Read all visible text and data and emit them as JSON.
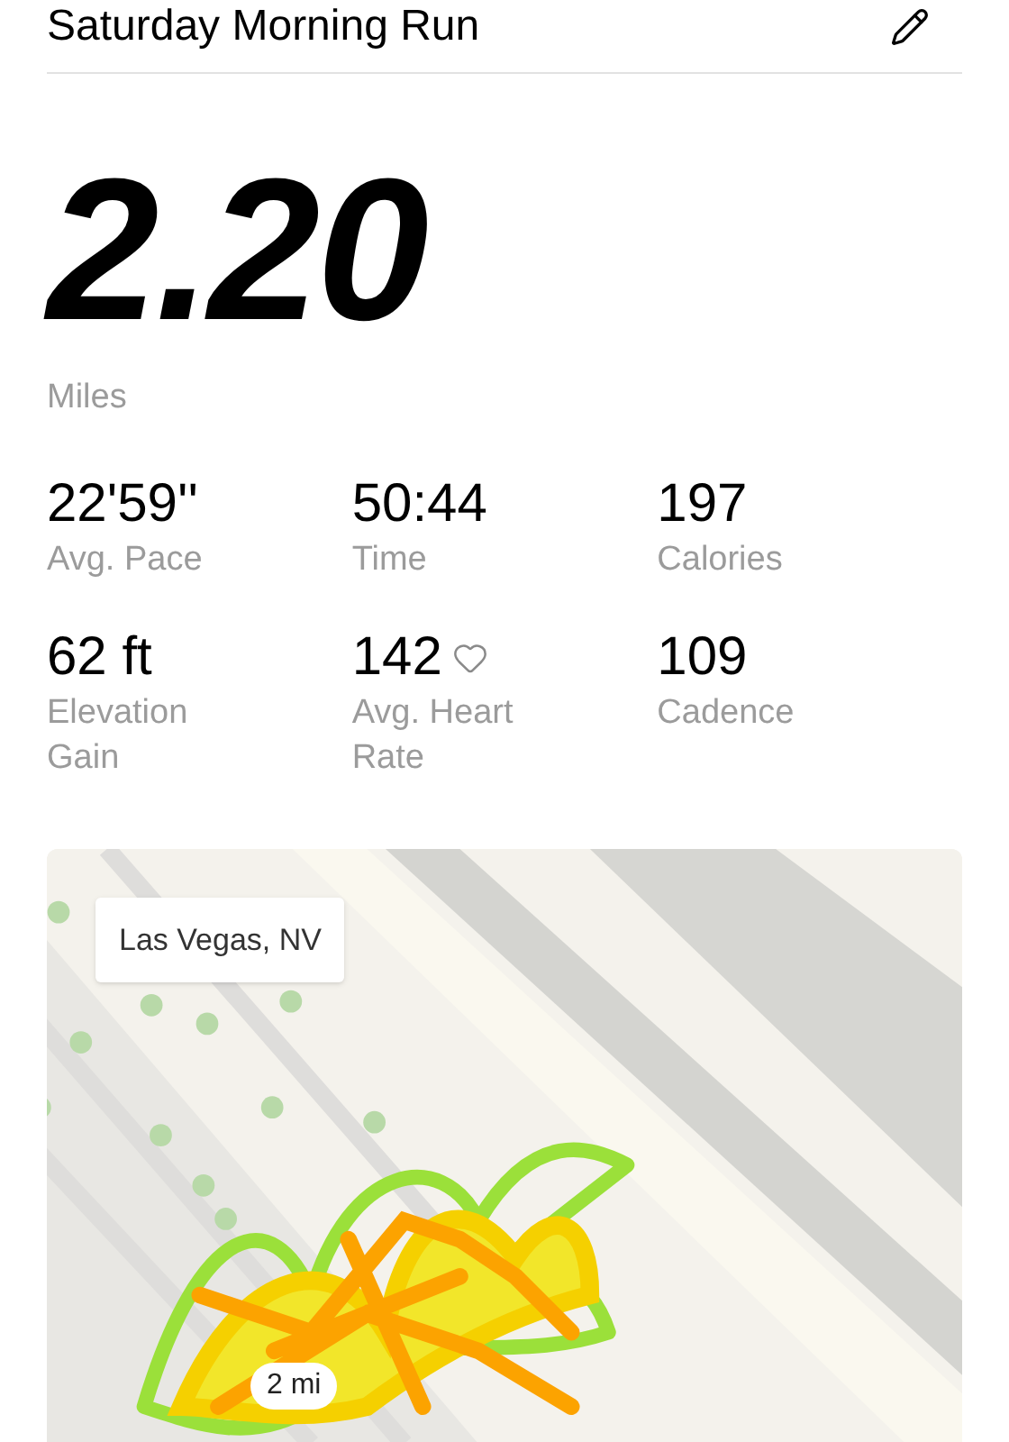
{
  "header": {
    "title": "Saturday Morning Run"
  },
  "distance": {
    "value": "2.20",
    "unit": "Miles"
  },
  "stats": [
    {
      "kind": "plain",
      "value": "22'59''",
      "label": "Avg. Pace"
    },
    {
      "kind": "plain",
      "value": "50:44",
      "label": "Time"
    },
    {
      "kind": "plain",
      "value": "197",
      "label": "Calories"
    },
    {
      "kind": "plain",
      "value": "62 ft",
      "label": "Elevation Gain"
    },
    {
      "kind": "heart",
      "value": "142",
      "label": "Avg. Heart Rate"
    },
    {
      "kind": "plain",
      "value": "109",
      "label": "Cadence"
    }
  ],
  "map": {
    "kind": "picture",
    "location_label": "Las Vegas, NV",
    "scale_label": "2 mi"
  }
}
